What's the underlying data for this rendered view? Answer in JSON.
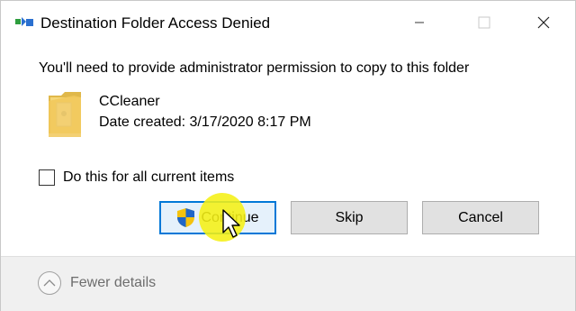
{
  "window": {
    "title": "Destination Folder Access Denied",
    "icons": {
      "app": "copy-transfer-icon",
      "minimize": "minimize-icon",
      "maximize": "maximize-icon",
      "close": "close-icon"
    }
  },
  "dialog": {
    "message": "You'll need to provide administrator permission to copy to this folder",
    "item": {
      "icon": "folder-icon",
      "name": "CCleaner",
      "date_created": "Date created: 3/17/2020 8:17 PM"
    },
    "checkbox": {
      "label": "Do this for all current items",
      "checked": false
    },
    "buttons": {
      "continue": {
        "label": "Continue",
        "icon": "uac-shield-icon"
      },
      "skip": {
        "label": "Skip"
      },
      "cancel": {
        "label": "Cancel"
      }
    },
    "details_toggle": {
      "label": "Fewer details",
      "icon": "chevron-up-icon"
    }
  },
  "colors": {
    "accent": "#0078d7",
    "highlight": "#f5f014",
    "panel": "#f0f0f0"
  }
}
